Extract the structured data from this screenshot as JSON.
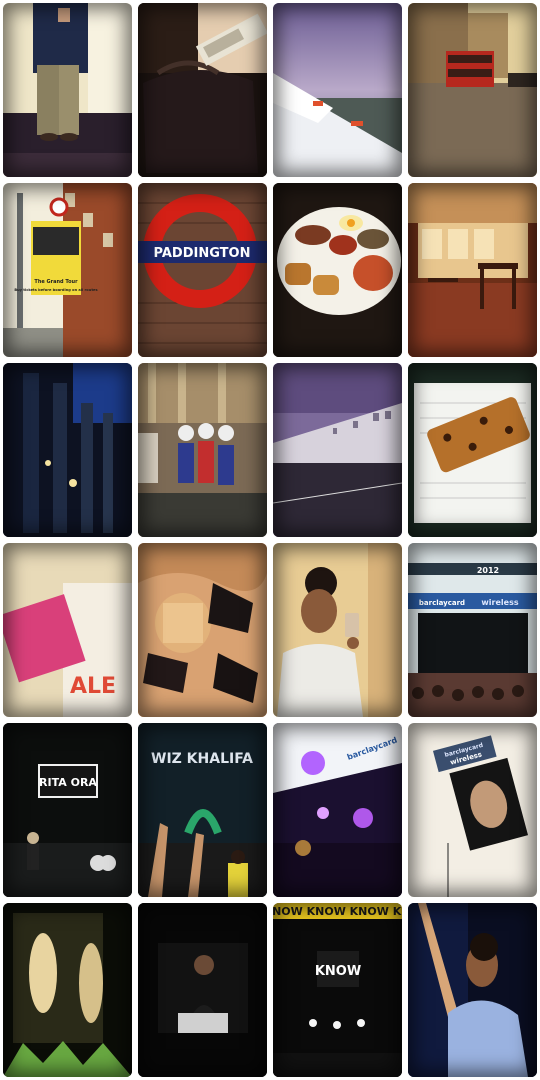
{
  "tiles": [
    {
      "id": "mirror-selfie",
      "texts": []
    },
    {
      "id": "suitcase-tag",
      "texts": []
    },
    {
      "id": "airplane-wing",
      "texts": []
    },
    {
      "id": "london-street-bus",
      "texts": []
    },
    {
      "id": "bus-stop-sign",
      "texts": [
        "Buy tickets before boarding on all routes",
        "The Grand Tour"
      ]
    },
    {
      "id": "paddington-sign",
      "texts": [
        "PADDINGTON"
      ]
    },
    {
      "id": "english-breakfast",
      "texts": []
    },
    {
      "id": "pub-interior",
      "texts": []
    },
    {
      "id": "night-columns",
      "texts": []
    },
    {
      "id": "parade-costumes",
      "texts": []
    },
    {
      "id": "terrace-street",
      "texts": []
    },
    {
      "id": "leopard-wallet",
      "texts": []
    },
    {
      "id": "shopping-bags",
      "texts": [
        "ALE"
      ]
    },
    {
      "id": "shoes-on-bed",
      "texts": []
    },
    {
      "id": "selfie-phone",
      "texts": []
    },
    {
      "id": "stage-banner",
      "texts": [
        "2012",
        "barclaycard",
        "wireless"
      ]
    },
    {
      "id": "rita-ora-stage",
      "texts": [
        "RITA ORA"
      ]
    },
    {
      "id": "wiz-khalifa-stage",
      "texts": [
        "WIZ KHALIFA"
      ]
    },
    {
      "id": "purple-stage-lights",
      "texts": [
        "barclaycard"
      ]
    },
    {
      "id": "screen-performer",
      "texts": [
        "barclaycard",
        "wireless"
      ]
    },
    {
      "id": "concert-screen-woman",
      "texts": []
    },
    {
      "id": "rapper-screen",
      "texts": []
    },
    {
      "id": "know-banner",
      "texts": [
        "KNOW KNOW KNOW KN",
        "KNOW"
      ]
    },
    {
      "id": "performer-arm-raised",
      "texts": []
    }
  ]
}
